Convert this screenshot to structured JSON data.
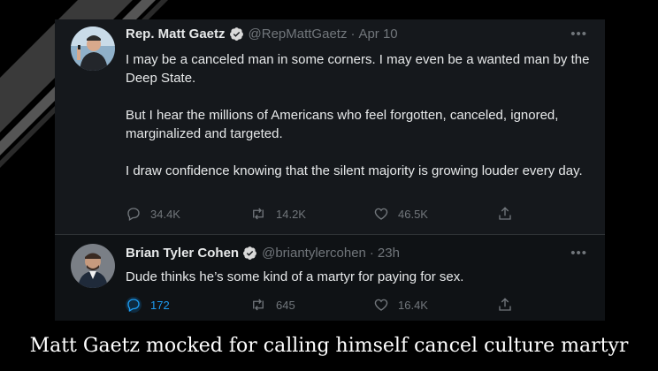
{
  "tweet1": {
    "name": "Rep. Matt Gaetz",
    "handle": "@RepMattGaetz",
    "date": "Apr 10",
    "more": "•••",
    "paragraphs": [
      "I may be a canceled man in some corners. I may even be a wanted man by the Deep State.",
      "But I hear the millions of Americans who feel forgotten, canceled, ignored, marginalized and targeted.",
      "I draw confidence knowing that the silent majority is growing louder every day."
    ],
    "replies": "34.4K",
    "retweets": "14.2K",
    "likes": "46.5K"
  },
  "tweet2": {
    "name": "Brian Tyler Cohen",
    "handle": "@briantylercohen",
    "date": "23h",
    "more": "•••",
    "text": "Dude thinks he’s some kind of a martyr for paying for sex.",
    "replies": "172",
    "retweets": "645",
    "likes": "16.4K"
  },
  "caption": "Matt Gaetz mocked for calling himself cancel culture martyr",
  "icons": {
    "verified": "verified-badge-icon",
    "reply": "reply-icon",
    "retweet": "retweet-icon",
    "like": "like-icon",
    "share": "share-icon"
  },
  "colors": {
    "background": "#000000",
    "card": "#15181c",
    "text": "#e7e9ea",
    "muted": "#71767b",
    "accent": "#1d9bf0"
  }
}
